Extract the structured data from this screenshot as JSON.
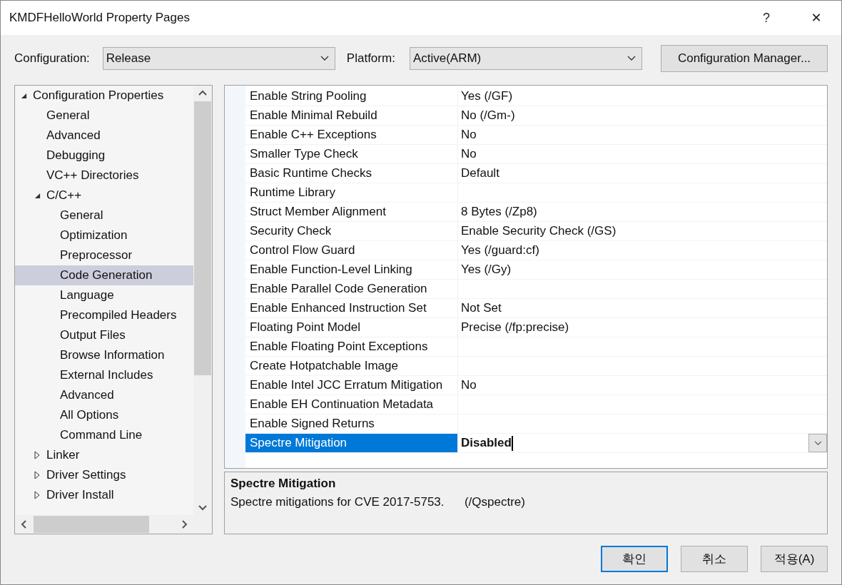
{
  "window": {
    "title": "KMDFHelloWorld Property Pages",
    "help": "?",
    "close": "✕"
  },
  "toolbar": {
    "configuration_label": "Configuration:",
    "configuration": "Release",
    "platform_label": "Platform:",
    "platform": "Active(ARM)",
    "manager_button": "Configuration Manager..."
  },
  "tree": [
    {
      "label": "Configuration Properties",
      "expanded": true,
      "selected": false,
      "children": [
        {
          "label": "General",
          "selected": false
        },
        {
          "label": "Advanced",
          "selected": false
        },
        {
          "label": "Debugging",
          "selected": false
        },
        {
          "label": "VC++ Directories",
          "selected": false
        },
        {
          "label": "C/C++",
          "expanded": true,
          "selected": false,
          "children": [
            {
              "label": "General",
              "selected": false
            },
            {
              "label": "Optimization",
              "selected": false
            },
            {
              "label": "Preprocessor",
              "selected": false
            },
            {
              "label": "Code Generation",
              "selected": true
            },
            {
              "label": "Language",
              "selected": false
            },
            {
              "label": "Precompiled Headers",
              "selected": false
            },
            {
              "label": "Output Files",
              "selected": false
            },
            {
              "label": "Browse Information",
              "selected": false
            },
            {
              "label": "External Includes",
              "selected": false
            },
            {
              "label": "Advanced",
              "selected": false
            },
            {
              "label": "All Options",
              "selected": false
            },
            {
              "label": "Command Line",
              "selected": false
            }
          ]
        },
        {
          "label": "Linker",
          "expanded": false,
          "selected": false
        },
        {
          "label": "Driver Settings",
          "expanded": false,
          "selected": false
        },
        {
          "label": "Driver Install",
          "expanded": false,
          "selected": false
        }
      ]
    }
  ],
  "properties": [
    {
      "name": "Enable String Pooling",
      "value": "Yes (/GF)",
      "selected": false
    },
    {
      "name": "Enable Minimal Rebuild",
      "value": "No (/Gm-)",
      "selected": false
    },
    {
      "name": "Enable C++ Exceptions",
      "value": "No",
      "selected": false
    },
    {
      "name": "Smaller Type Check",
      "value": "No",
      "selected": false
    },
    {
      "name": "Basic Runtime Checks",
      "value": "Default",
      "selected": false
    },
    {
      "name": "Runtime Library",
      "selected": false
    },
    {
      "name": "Struct Member Alignment",
      "value": "8 Bytes (/Zp8)",
      "selected": false
    },
    {
      "name": "Security Check",
      "value": "Enable Security Check (/GS)",
      "selected": false
    },
    {
      "name": "Control Flow Guard",
      "value": "Yes (/guard:cf)",
      "selected": false
    },
    {
      "name": "Enable Function-Level Linking",
      "value": "Yes (/Gy)",
      "selected": false
    },
    {
      "name": "Enable Parallel Code Generation",
      "selected": false
    },
    {
      "name": "Enable Enhanced Instruction Set",
      "value": "Not Set",
      "selected": false
    },
    {
      "name": "Floating Point Model",
      "value": "Precise (/fp:precise)",
      "selected": false
    },
    {
      "name": "Enable Floating Point Exceptions",
      "selected": false
    },
    {
      "name": "Create Hotpatchable Image",
      "selected": false
    },
    {
      "name": "Enable Intel JCC Erratum Mitigation",
      "value": "No",
      "selected": false
    },
    {
      "name": "Enable EH Continuation Metadata",
      "selected": false
    },
    {
      "name": "Enable Signed Returns",
      "selected": false
    },
    {
      "name": "Spectre Mitigation",
      "value": "Disabled",
      "selected": true
    }
  ],
  "description": {
    "title": "Spectre Mitigation",
    "text": "Spectre mitigations for CVE 2017-5753.      (/Qspectre)"
  },
  "buttons": [
    {
      "label": "확인",
      "default": true
    },
    {
      "label": "취소",
      "default": false
    },
    {
      "label": "적용(A)",
      "default": false
    }
  ]
}
